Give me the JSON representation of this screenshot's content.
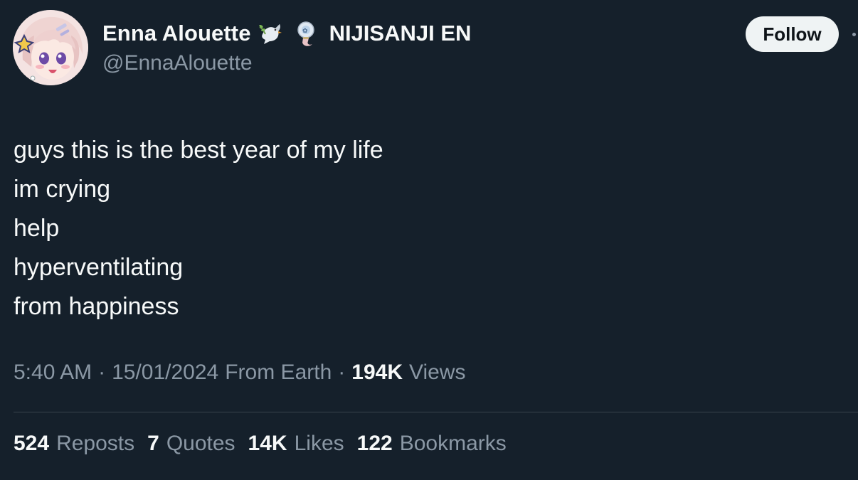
{
  "author": {
    "display_name": "Enna Alouette",
    "affiliation": "NIJISANJI EN",
    "handle": "@EnnaAlouette",
    "emojis": [
      "dove-with-branch-icon",
      "ghost-lantern-icon"
    ]
  },
  "actions": {
    "follow_label": "Follow"
  },
  "tweet": {
    "lines": [
      "guys this is the best year of my life",
      "im crying",
      "help",
      "hyperventilating",
      "from happiness"
    ]
  },
  "meta": {
    "time": "5:40 AM",
    "separator": "·",
    "date": "15/01/2024",
    "source": "From Earth",
    "views_count": "194K",
    "views_label": "Views"
  },
  "stats": {
    "reposts_count": "524",
    "reposts_label": "Reposts",
    "quotes_count": "7",
    "quotes_label": "Quotes",
    "likes_count": "14K",
    "likes_label": "Likes",
    "bookmarks_count": "122",
    "bookmarks_label": "Bookmarks"
  },
  "colors": {
    "background": "#15202b",
    "text_primary": "#f7f9f9",
    "text_secondary": "#8b98a5",
    "divider": "#38444d",
    "follow_bg": "#eff3f4"
  }
}
